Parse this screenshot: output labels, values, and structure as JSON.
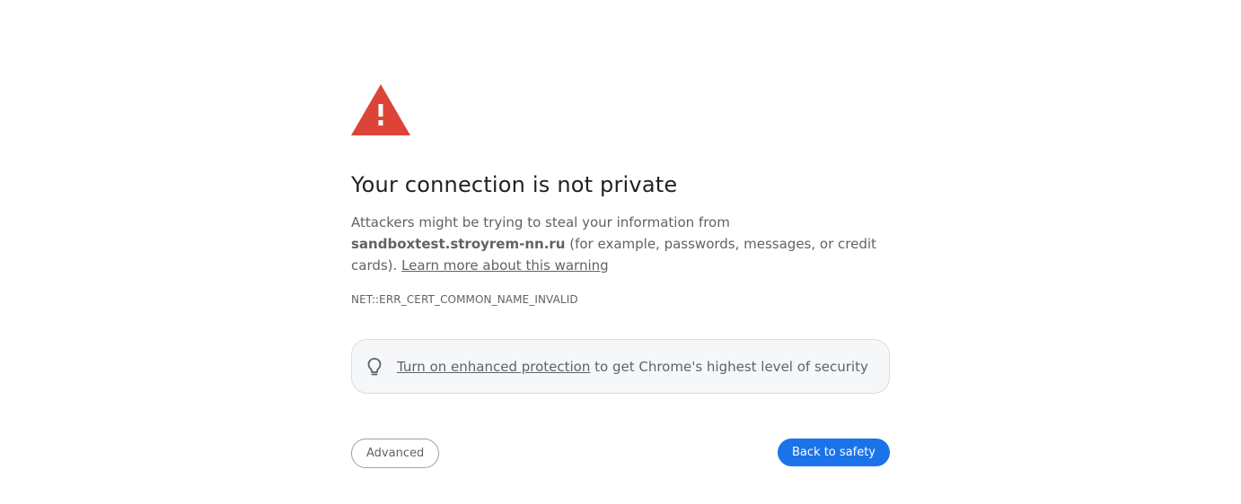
{
  "heading": "Your connection is not private",
  "explanation": {
    "before_host": "Attackers might be trying to steal your information from ",
    "host": "sandboxtest.stroyrem-nn.ru",
    "after_host": " (for example, passwords, messages, or credit cards). ",
    "learn_more": "Learn more about this warning"
  },
  "error_code": "NET::ERR_CERT_COMMON_NAME_INVALID",
  "promo": {
    "icon": "lightbulb-icon",
    "link_text": "Turn on enhanced protection",
    "rest_text": " to get Chrome's highest level of security"
  },
  "buttons": {
    "advanced": "Advanced",
    "back_to_safety": "Back to safety"
  },
  "colors": {
    "warning_red": "#db4437",
    "primary_blue": "#1a73e8",
    "secondary_text": "#5f6368"
  }
}
